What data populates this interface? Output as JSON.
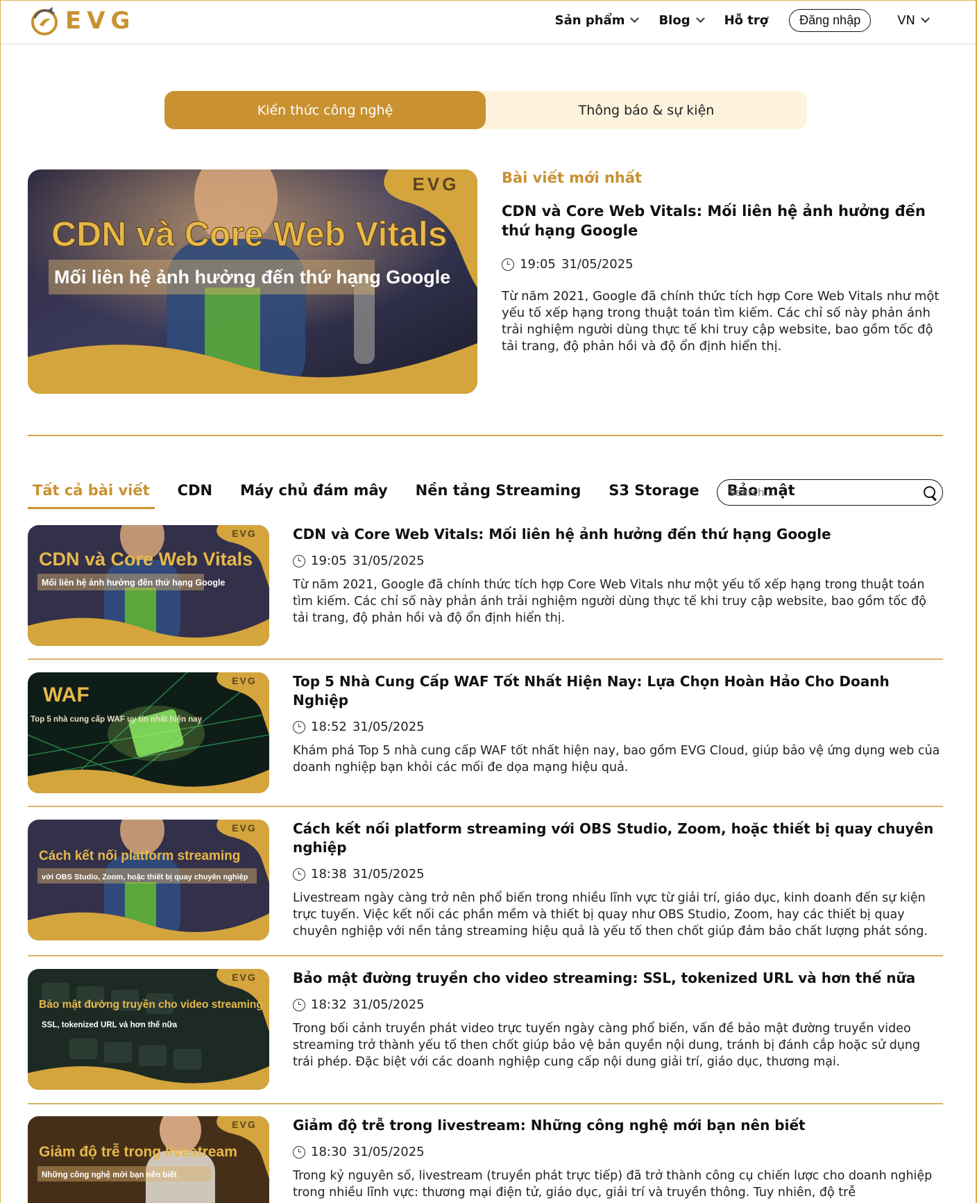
{
  "header": {
    "logo_text": "EVG",
    "nav": [
      {
        "label": "Sản phẩm",
        "has_dropdown": true
      },
      {
        "label": "Blog",
        "has_dropdown": true
      },
      {
        "label": "Hỗ trợ",
        "has_dropdown": false
      }
    ],
    "login_label": "Đăng nhập",
    "language": "VN"
  },
  "top_tabs": [
    "Kiến thức công nghệ",
    "Thông báo & sự kiện"
  ],
  "featured": {
    "section_label": "Bài viết mới nhất",
    "title": "CDN và Core Web Vitals: Mối liên hệ ảnh hưởng đến thứ hạng Google",
    "time": "19:05",
    "date": "31/05/2025",
    "description": "Từ năm 2021, Google đã chính thức tích hợp Core Web Vitals như một yếu tố xếp hạng trong thuật toán tìm kiếm. Các chỉ số này phản ánh trải nghiệm người dùng thực tế khi truy cập website, bao gồm tốc độ tải trang, độ phản hồi và độ ổn định hiển thị.",
    "image": {
      "brand": "EVG",
      "headline": "CDN và Core Web Vitals",
      "subline": "Mối liên hệ ảnh hưởng đến thứ hạng Google"
    }
  },
  "categories": [
    "Tất cả bài viết",
    "CDN",
    "Máy chủ đám mây",
    "Nền tảng Streaming",
    "S3 Storage",
    "Bảo mật"
  ],
  "search": {
    "placeholder": "Search..."
  },
  "articles": [
    {
      "title": "CDN và Core Web Vitals: Mối liên hệ ảnh hưởng đến thứ hạng Google",
      "time": "19:05",
      "date": "31/05/2025",
      "description": "Từ năm 2021, Google đã chính thức tích hợp Core Web Vitals như một yếu tố xếp hạng trong thuật toán tìm kiếm. Các chỉ số này phản ánh trải nghiệm người dùng thực tế khi truy cập website, bao gồm tốc độ tải trang, độ phản hồi và độ ổn định hiển thị.",
      "image": {
        "brand": "EVG",
        "headline": "CDN và Core Web Vitals",
        "subline": "Mối liên hệ ảnh hưởng đến thứ hạng Google"
      }
    },
    {
      "title": "Top 5 Nhà Cung Cấp WAF Tốt Nhất Hiện Nay: Lựa Chọn Hoàn Hảo Cho Doanh Nghiệp",
      "time": "18:52",
      "date": "31/05/2025",
      "description": "Khám phá Top 5 nhà cung cấp WAF tốt nhất hiện nay, bao gồm EVG Cloud, giúp bảo vệ ứng dụng web của doanh nghiệp bạn khỏi các mối đe dọa mạng hiệu quả.",
      "image": {
        "brand": "EVG",
        "headline": "WAF",
        "subline": "Top 5 nhà cung cấp WAF uy tín nhất hiện nay"
      }
    },
    {
      "title": "Cách kết nối platform streaming với OBS Studio, Zoom, hoặc thiết bị quay chuyên nghiệp",
      "time": "18:38",
      "date": "31/05/2025",
      "description": "Livestream ngày càng trở nên phổ biến trong nhiều lĩnh vực từ giải trí, giáo dục, kinh doanh đến sự kiện trực tuyến. Việc kết nối các phần mềm và thiết bị quay như OBS Studio, Zoom, hay các thiết bị quay chuyên nghiệp với nền tảng streaming hiệu quả là yếu tố then chốt giúp đảm bảo chất lượng phát sóng.",
      "image": {
        "brand": "EVG",
        "headline": "Cách kết nối platform streaming",
        "subline": "với OBS Studio, Zoom, hoặc thiết bị quay chuyên nghiệp"
      }
    },
    {
      "title": "Bảo mật đường truyền cho video streaming: SSL, tokenized URL và hơn thế nữa",
      "time": "18:32",
      "date": "31/05/2025",
      "description": "Trong bối cảnh truyền phát video trực tuyến ngày càng phổ biến, vấn đề bảo mật đường truyền video streaming trở thành yếu tố then chốt giúp bảo vệ bản quyền nội dung, tránh bị đánh cắp hoặc sử dụng trái phép. Đặc biệt với các doanh nghiệp cung cấp nội dung giải trí, giáo dục, thương mại.",
      "image": {
        "brand": "EVG",
        "headline": "Bảo mật đường truyền cho video streaming",
        "subline": "SSL, tokenized URL và hơn thế nữa"
      }
    },
    {
      "title": "Giảm độ trễ trong livestream: Những công nghệ mới bạn nên biết",
      "time": "18:30",
      "date": "31/05/2025",
      "description": "Trong kỷ nguyên số, livestream (truyền phát trực tiếp) đã trở thành công cụ chiến lược cho doanh nghiệp trong nhiều lĩnh vực: thương mại điện tử, giáo dục, giải trí và truyền thông. Tuy nhiên, độ trễ",
      "image": {
        "brand": "EVG",
        "headline": "Giảm độ trễ trong livestream",
        "subline": "Những công nghệ mới bạn nên biết"
      }
    }
  ],
  "colors": {
    "accent": "#c99130",
    "tab_bg": "#fdf3dd",
    "divider": "#d4a348"
  }
}
